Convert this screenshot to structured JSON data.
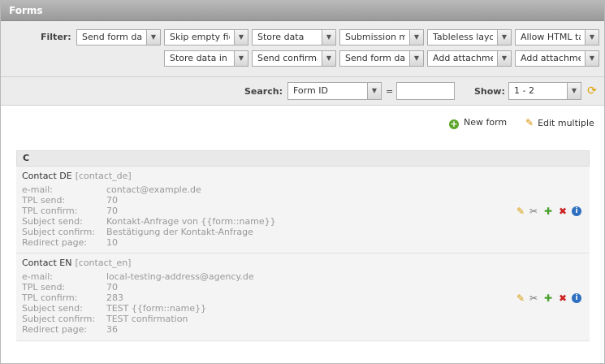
{
  "window": {
    "title": "Forms"
  },
  "filter": {
    "label": "Filter:",
    "row1": [
      "Send form data v",
      "Skip empty fields",
      "Store data",
      "Submission meth",
      "Tableless layout",
      "Allow HTML tags"
    ],
    "row2": [
      "Store data in mo",
      "Send confirmati",
      "Send form data v",
      "Add attachment",
      "Add attachment"
    ]
  },
  "search": {
    "label": "Search:",
    "field": "Form ID",
    "operator": "=",
    "value": "",
    "show_label": "Show:",
    "show_value": "1 - 2"
  },
  "actions": {
    "new_form": "New form",
    "edit_multiple": "Edit multiple"
  },
  "group": {
    "title": "C",
    "entries": [
      {
        "name": "Contact DE",
        "key": "[contact_de]",
        "fields": [
          {
            "label": "e-mail:",
            "value": "contact@example.de"
          },
          {
            "label": "TPL send:",
            "value": "70"
          },
          {
            "label": "TPL confirm:",
            "value": "70"
          },
          {
            "label": "Subject send:",
            "value": "Kontakt-Anfrage von {{form::name}}"
          },
          {
            "label": "Subject confirm:",
            "value": "Bestätigung der Kontakt-Anfrage"
          },
          {
            "label": "Redirect page:",
            "value": "10"
          }
        ]
      },
      {
        "name": "Contact EN",
        "key": "[contact_en]",
        "fields": [
          {
            "label": "e-mail:",
            "value": "local-testing-address@agency.de"
          },
          {
            "label": "TPL send:",
            "value": "70"
          },
          {
            "label": "TPL confirm:",
            "value": "283"
          },
          {
            "label": "Subject send:",
            "value": "TEST {{form::name}}"
          },
          {
            "label": "Subject confirm:",
            "value": "TEST confirmation"
          },
          {
            "label": "Redirect page:",
            "value": "36"
          }
        ]
      }
    ]
  },
  "icons": {
    "edit": "pencil-icon",
    "settings": "tools-icon",
    "copy": "plus-icon",
    "delete": "x-icon",
    "info": "info-icon",
    "refresh": "refresh-icon"
  }
}
